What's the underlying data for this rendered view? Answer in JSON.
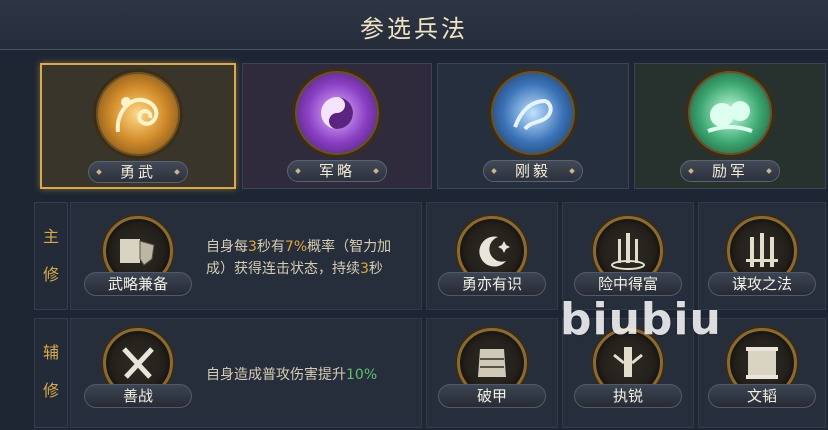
{
  "title": "参选兵法",
  "tabs": [
    {
      "label": "勇武",
      "active": true,
      "color": "#e8b552"
    },
    {
      "label": "军略",
      "active": false,
      "color": "#b866e0"
    },
    {
      "label": "刚毅",
      "active": false,
      "color": "#6aa6f0"
    },
    {
      "label": "励军",
      "active": false,
      "color": "#7fd8a6"
    }
  ],
  "main": {
    "side_label": [
      "主",
      "修"
    ],
    "selected": {
      "name": "武略兼备",
      "icon": "scroll-shield-icon"
    },
    "desc_parts": [
      "自身每",
      "3",
      "秒有",
      "7%",
      "概率（智力加",
      "成）获得连击状态，持续",
      "3",
      "秒"
    ],
    "options": [
      {
        "name": "勇亦有识",
        "icon": "crescent-moon-icon"
      },
      {
        "name": "险中得富",
        "icon": "swords-ring-icon"
      },
      {
        "name": "谋攻之法",
        "icon": "triple-swords-icon"
      }
    ]
  },
  "sub": {
    "side_label": [
      "辅",
      "修"
    ],
    "selected": {
      "name": "善战",
      "icon": "crossed-swords-icon"
    },
    "desc_parts": [
      "自身造成普攻伤害提升",
      "10%"
    ],
    "options": [
      {
        "name": "破甲",
        "icon": "armor-icon"
      },
      {
        "name": "执锐",
        "icon": "blade-icon"
      },
      {
        "name": "文韬",
        "icon": "scroll-icon"
      }
    ]
  },
  "watermark": "biubiu"
}
